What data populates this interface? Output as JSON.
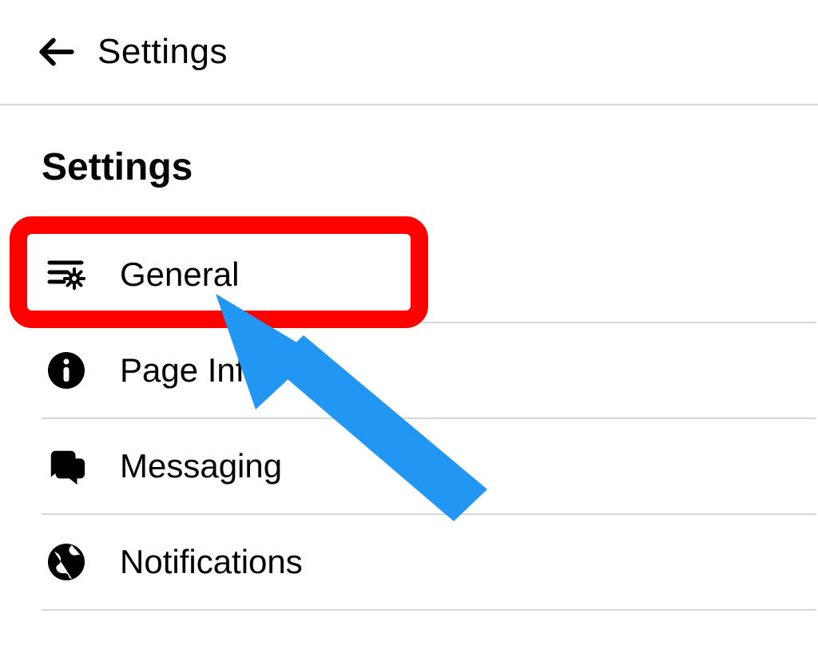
{
  "header": {
    "title": "Settings"
  },
  "section": {
    "title": "Settings"
  },
  "menu": {
    "items": [
      {
        "label": "General"
      },
      {
        "label": "Page Info"
      },
      {
        "label": "Messaging"
      },
      {
        "label": "Notifications"
      }
    ]
  },
  "annotation": {
    "highlight_color": "#ff0000",
    "arrow_color": "#2196f3"
  }
}
